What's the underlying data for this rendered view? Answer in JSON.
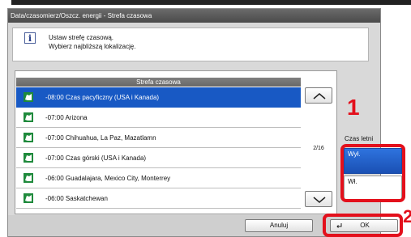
{
  "dialog": {
    "title": "Data/czasomierz/Oszcz. energii - Strefa czasowa",
    "info_text": "Ustaw strefę czasową.\nWybierz najbliższą lokalizację."
  },
  "timezone_list": {
    "header": "Strefa czasowa",
    "items": [
      {
        "label": "-08:00 Czas pacyficzny (USA i Kanada)",
        "selected": true
      },
      {
        "label": "-07:00 Arizona",
        "selected": false
      },
      {
        "label": "-07:00 Chihuahua, La Paz, Mazatlamn",
        "selected": false
      },
      {
        "label": "-07:00 Czas górski (USA i Kanada)",
        "selected": false
      },
      {
        "label": "-06:00 Guadalajara, Mexico City, Monterrey",
        "selected": false
      },
      {
        "label": "-06:00 Saskatchewan",
        "selected": false
      }
    ],
    "page_indicator": "2/16",
    "item_icon": "globe-icon"
  },
  "dst": {
    "label": "Czas letni",
    "off_label": "Wył.",
    "on_label": "Wł.",
    "selected": "off"
  },
  "buttons": {
    "cancel": "Anuluj",
    "ok": "OK"
  },
  "annotations": {
    "step1": "1",
    "step2": "2"
  },
  "colors": {
    "selection": "#1859c4",
    "highlight": "#e3101c"
  }
}
